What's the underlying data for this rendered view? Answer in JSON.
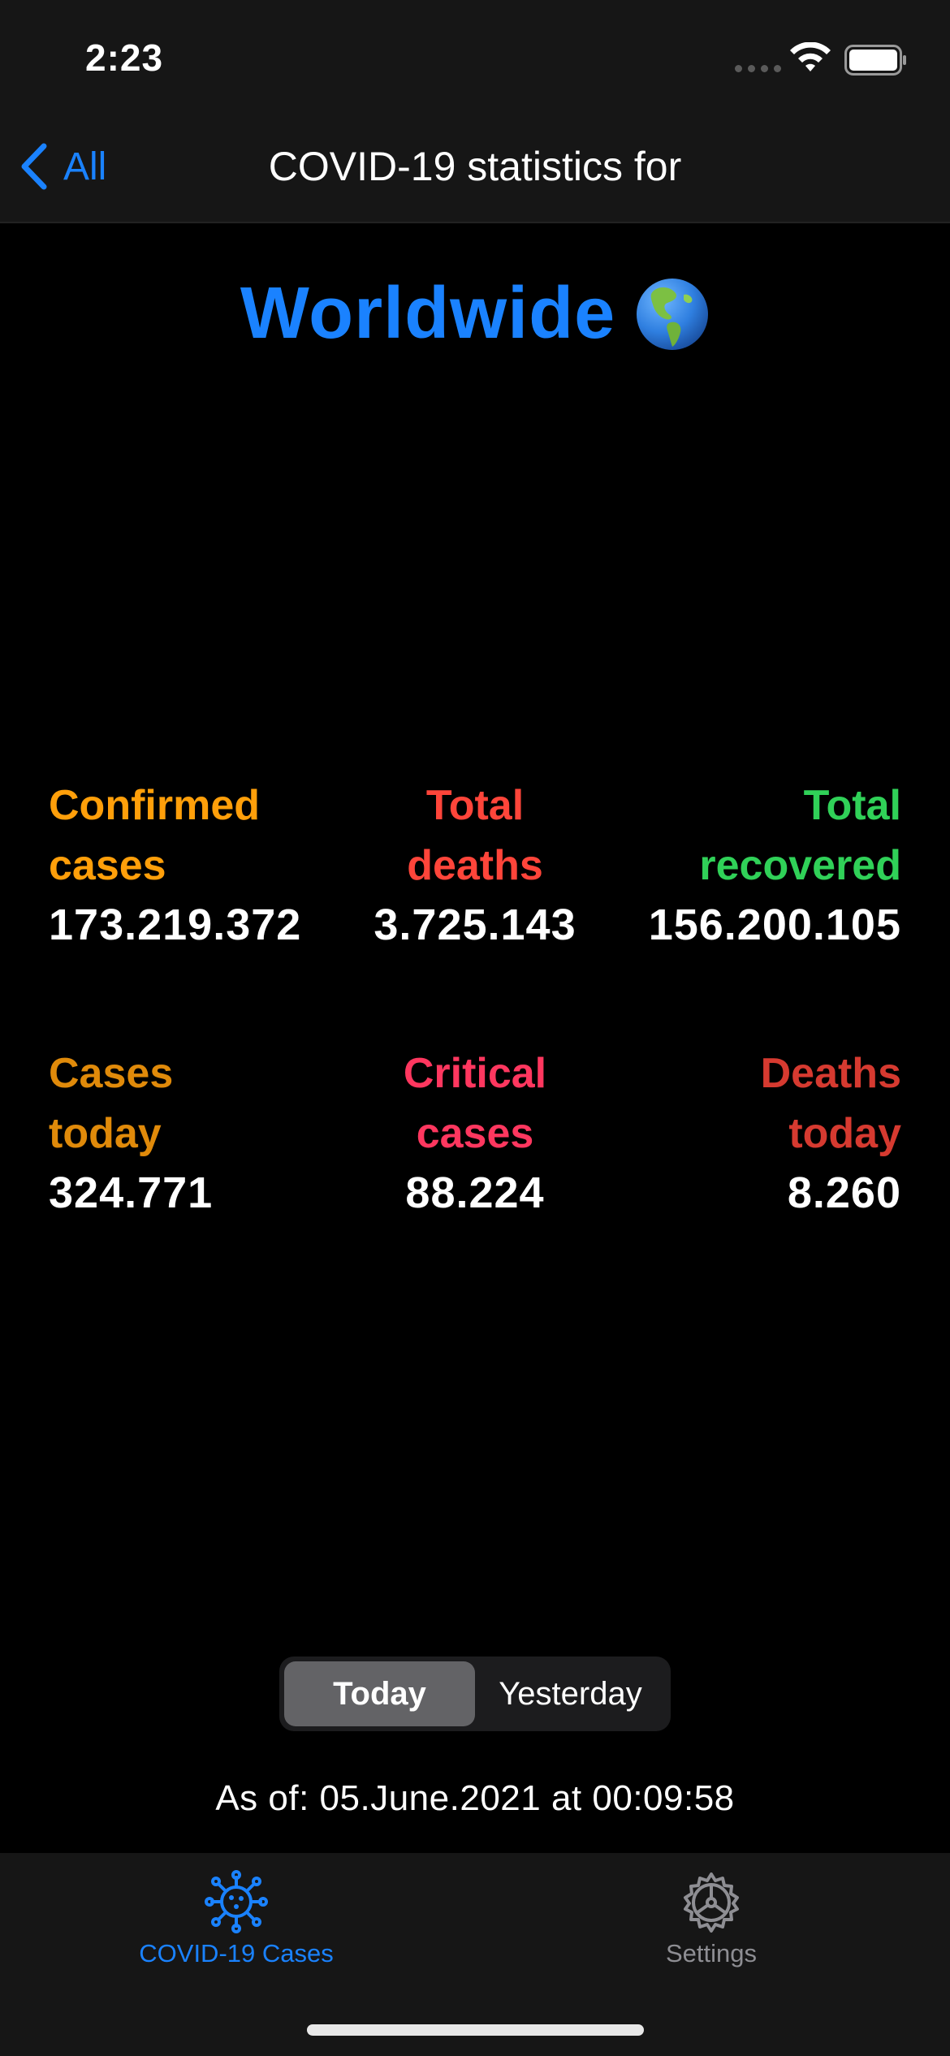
{
  "status_bar": {
    "time": "2:23"
  },
  "nav": {
    "back_label": "All",
    "title": "COVID-19 statistics for"
  },
  "region": {
    "name": "Worldwide",
    "icon": "globe-americas-icon"
  },
  "stats": [
    {
      "label": "Confirmed\ncases",
      "value": "173.219.372",
      "color": "#ff9f0a",
      "align": "left",
      "key": "confirmed"
    },
    {
      "label": "Total\ndeaths",
      "value": "3.725.143",
      "color": "#ff453a",
      "align": "center",
      "key": "deaths"
    },
    {
      "label": "Total\nrecovered",
      "value": "156.200.105",
      "color": "#30d158",
      "align": "right",
      "key": "recovered"
    },
    {
      "label": "Cases\ntoday",
      "value": "324.771",
      "color": "#e08a0a",
      "align": "left",
      "key": "cases-today"
    },
    {
      "label": "Critical\ncases",
      "value": "88.224",
      "color": "#ff375f",
      "align": "center",
      "key": "critical"
    },
    {
      "label": "Deaths\ntoday",
      "value": "8.260",
      "color": "#d63a30",
      "align": "right",
      "key": "deaths-today"
    }
  ],
  "segments": {
    "selected": "Today",
    "options": [
      "Today",
      "Yesterday"
    ]
  },
  "as_of": "As of: 05.June.2021 at 00:09:58",
  "tabs": [
    {
      "label": "COVID-19 Cases",
      "icon": "virus-icon",
      "active": true
    },
    {
      "label": "Settings",
      "icon": "gear-icon",
      "active": false
    }
  ],
  "colors": {
    "accent": "#1a82ff",
    "inactive": "#8e8e93",
    "background": "#000000"
  }
}
